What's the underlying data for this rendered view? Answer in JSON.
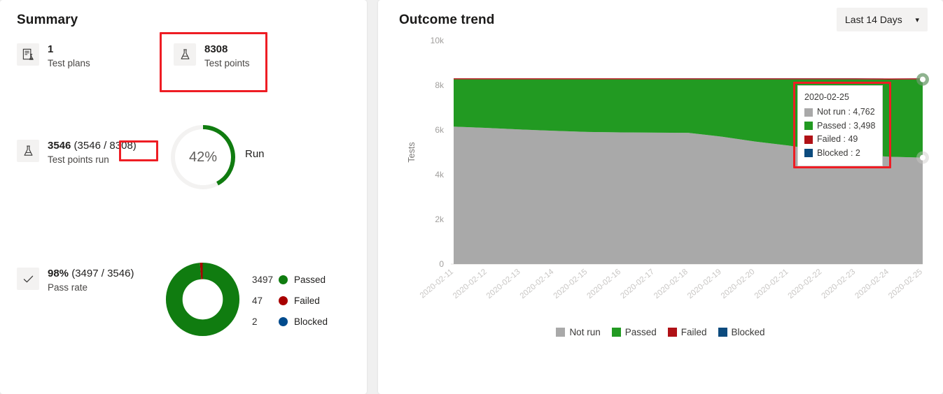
{
  "summary": {
    "title": "Summary",
    "metrics": [
      {
        "value": "1",
        "label": "Test plans",
        "icon": "test-plan-icon"
      },
      {
        "value": "8308",
        "label": "Test points",
        "icon": "flask-icon"
      },
      {
        "value": "3546",
        "value_detail": "(3546 / 8308)",
        "label": "Test points run",
        "icon": "flask-icon"
      },
      {
        "value": "98%",
        "value_detail": "(3497 / 3546)",
        "label": "Pass rate",
        "icon": "checkmark-icon"
      }
    ],
    "run_ring": {
      "percent_label": "42%",
      "percent": 42,
      "label": "Run",
      "color": "#107c10",
      "track": "#f3f2f1"
    },
    "outcome_donut": {
      "legend": [
        {
          "count": "3497",
          "label": "Passed",
          "color": "#107c10",
          "value": 3497
        },
        {
          "count": "47",
          "label": "Failed",
          "color": "#a80000",
          "value": 47
        },
        {
          "count": "2",
          "label": "Blocked",
          "color": "#004b8d",
          "value": 2
        }
      ]
    }
  },
  "trend": {
    "title": "Outcome trend",
    "range_picker": {
      "label": "Last 14 Days",
      "chevron": "chevron-down-icon"
    },
    "tooltip": {
      "date": "2020-02-25",
      "rows": [
        {
          "label": "Not run : 4,762",
          "color": "#a9a9a9"
        },
        {
          "label": "Passed : 3,498",
          "color": "#229a22"
        },
        {
          "label": "Failed : 49",
          "color": "#b01116"
        },
        {
          "label": "Blocked : 2",
          "color": "#0c4b7e"
        }
      ]
    },
    "legend": [
      {
        "label": "Not run",
        "color": "#a9a9a9"
      },
      {
        "label": "Passed",
        "color": "#229a22"
      },
      {
        "label": "Failed",
        "color": "#b01116"
      },
      {
        "label": "Blocked",
        "color": "#0c4b7e"
      }
    ]
  },
  "chart_data": {
    "type": "area",
    "stacked": true,
    "title": "Outcome trend",
    "xlabel": "",
    "ylabel": "Tests",
    "ylim": [
      0,
      10000
    ],
    "yticks": [
      0,
      2000,
      4000,
      6000,
      8000,
      10000
    ],
    "ytick_labels": [
      "0",
      "2k",
      "4k",
      "6k",
      "8k",
      "10k"
    ],
    "grid": false,
    "legend_position": "bottom",
    "categories": [
      "2020-02-11",
      "2020-02-12",
      "2020-02-13",
      "2020-02-14",
      "2020-02-15",
      "2020-02-16",
      "2020-02-17",
      "2020-02-18",
      "2020-02-19",
      "2020-02-20",
      "2020-02-21",
      "2020-02-22",
      "2020-02-23",
      "2020-02-24",
      "2020-02-25"
    ],
    "series": [
      {
        "name": "Not run",
        "color": "#a9a9a9",
        "values": [
          6150,
          6090,
          6020,
          5960,
          5910,
          5890,
          5880,
          5870,
          5700,
          5480,
          5300,
          5080,
          4900,
          4800,
          4762
        ]
      },
      {
        "name": "Passed",
        "color": "#229a22",
        "values": [
          2110,
          2170,
          2240,
          2300,
          2350,
          2370,
          2380,
          2390,
          2560,
          2780,
          2960,
          3180,
          3360,
          3450,
          3498
        ]
      },
      {
        "name": "Failed",
        "color": "#b01116",
        "values": [
          47,
          47,
          47,
          47,
          47,
          47,
          47,
          49,
          49,
          49,
          49,
          49,
          49,
          49,
          49
        ]
      },
      {
        "name": "Blocked",
        "color": "#0c4b7e",
        "values": [
          2,
          2,
          2,
          2,
          2,
          2,
          2,
          2,
          2,
          2,
          2,
          2,
          2,
          2,
          2
        ]
      }
    ]
  }
}
